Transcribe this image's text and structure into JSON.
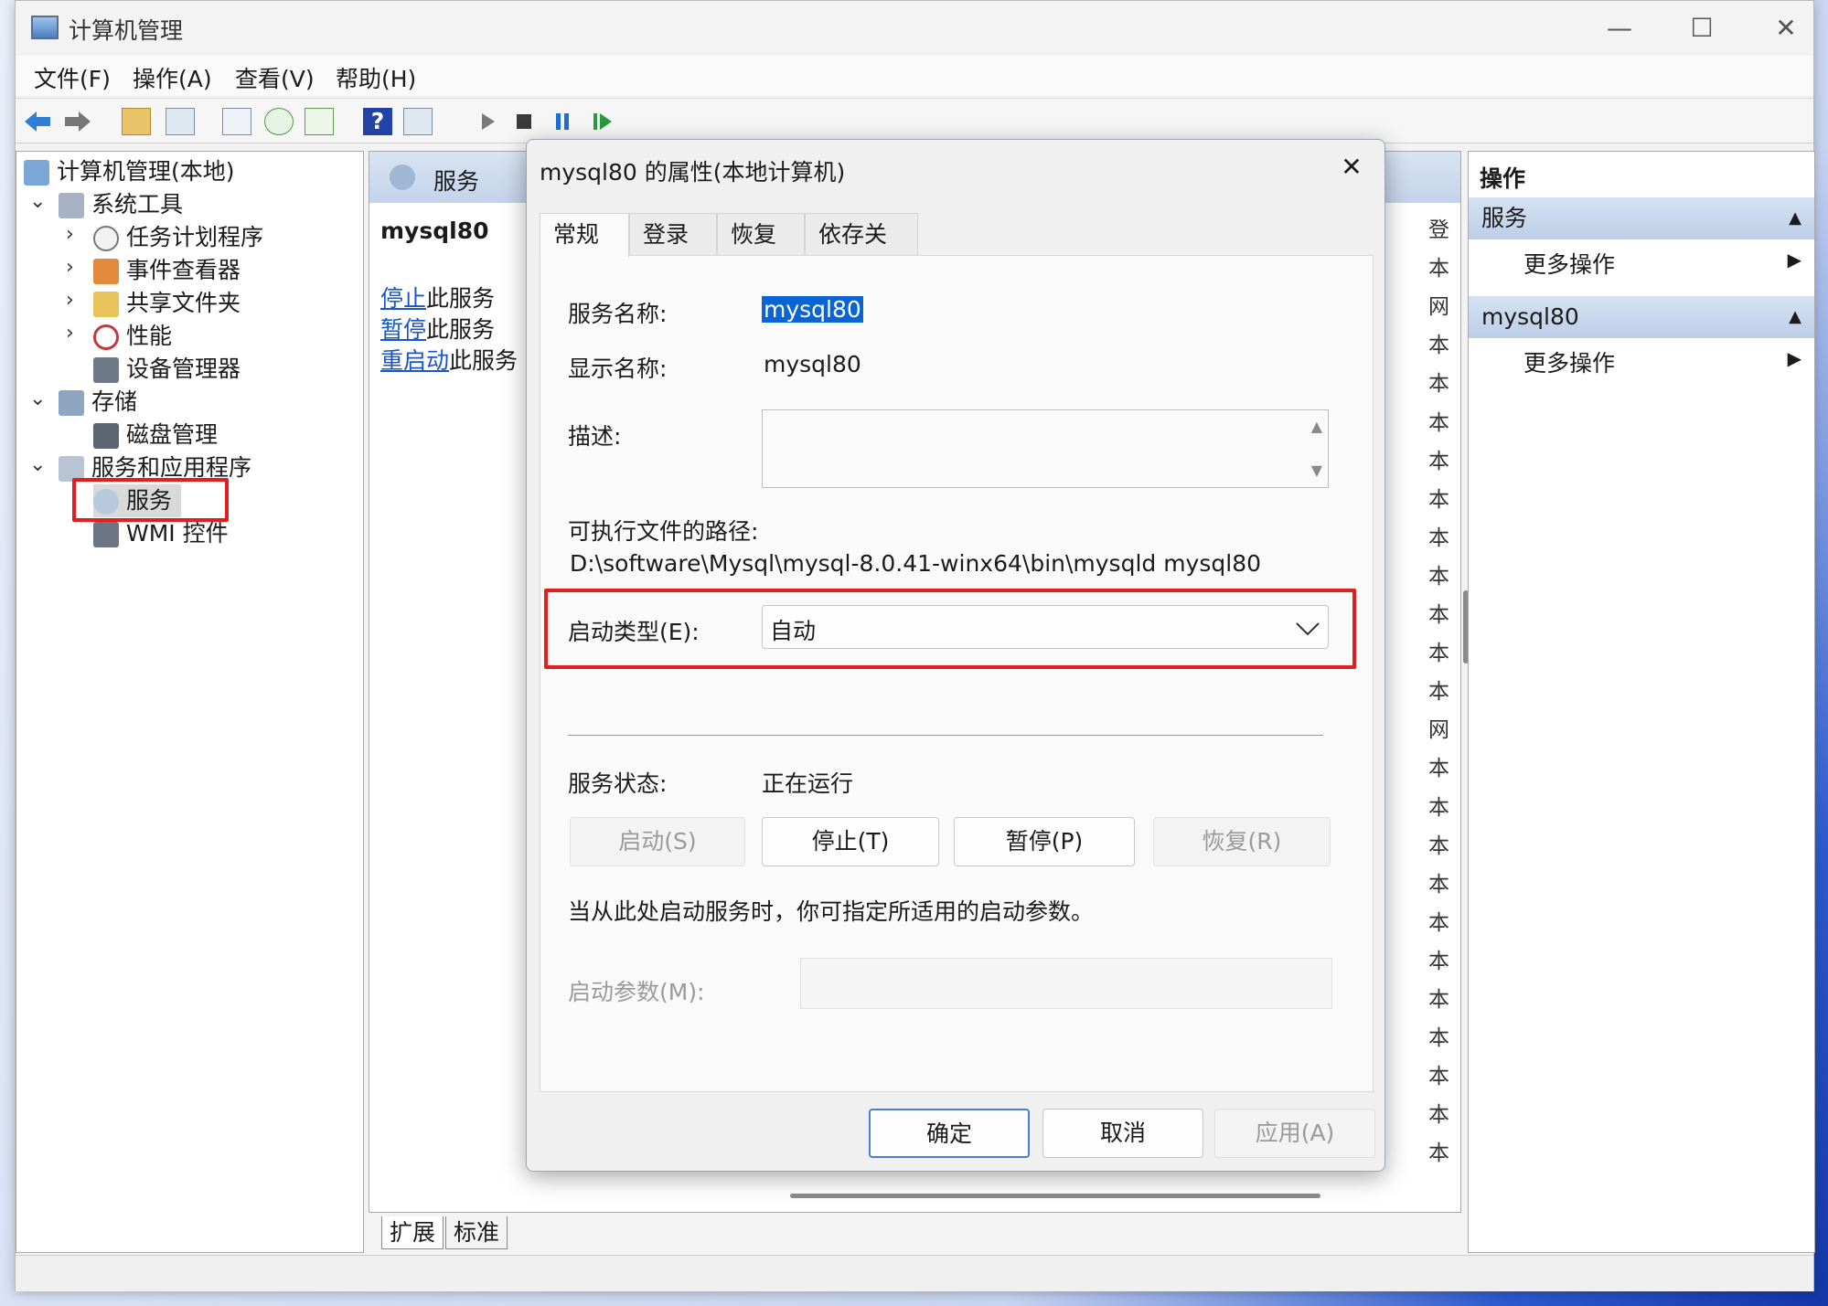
{
  "window": {
    "title": "计算机管理",
    "controls": {
      "minimize": "—",
      "maximize": "☐",
      "close": "✕"
    }
  },
  "menu": [
    "文件(F)",
    "操作(A)",
    "查看(V)",
    "帮助(H)"
  ],
  "tree": {
    "root": "计算机管理(本地)",
    "system_tools": "系统工具",
    "task_scheduler": "任务计划程序",
    "event_viewer": "事件查看器",
    "shared_folders": "共享文件夹",
    "performance": "性能",
    "device_manager": "设备管理器",
    "storage": "存储",
    "disk_mgmt": "磁盘管理",
    "services_apps": "服务和应用程序",
    "services": "服务",
    "wmi": "WMI 控件"
  },
  "middle": {
    "header": "服务",
    "service_name": "mysql80",
    "links": [
      {
        "link": "停止",
        "rest": "此服务"
      },
      {
        "link": "暂停",
        "rest": "此服务"
      },
      {
        "link": "重启动",
        "rest": "此服务"
      }
    ],
    "column_chars": [
      "登",
      "本",
      "网",
      "本",
      "本",
      "本",
      "本",
      "本",
      "本",
      "本",
      "本",
      "本",
      "本",
      "网",
      "本",
      "本",
      "本",
      "本",
      "本",
      "本",
      "本",
      "本",
      "本",
      "本",
      "本"
    ],
    "bottom_tabs": [
      "扩展",
      "标准"
    ]
  },
  "actions": {
    "title": "操作",
    "sections": [
      {
        "name": "服务",
        "more": "更多操作"
      },
      {
        "name": "mysql80",
        "more": "更多操作"
      }
    ]
  },
  "dialog": {
    "title": "mysql80 的属性(本地计算机)",
    "close": "✕",
    "tabs": [
      "常规",
      "登录",
      "恢复",
      "依存关系"
    ],
    "service_name_label": "服务名称:",
    "service_name": "mysql80",
    "display_name_label": "显示名称:",
    "display_name": "mysql80",
    "description_label": "描述:",
    "description": "",
    "exe_path_label": "可执行文件的路径:",
    "exe_path": "D:\\software\\Mysql\\mysql-8.0.41-winx64\\bin\\mysqld mysql80",
    "startup_type_label": "启动类型(E):",
    "startup_type": "自动",
    "status_label": "服务状态:",
    "status": "正在运行",
    "buttons": {
      "start": "启动(S)",
      "stop": "停止(T)",
      "pause": "暂停(P)",
      "resume": "恢复(R)"
    },
    "hint": "当从此处启动服务时，你可指定所适用的启动参数。",
    "params_label": "启动参数(M):",
    "params": "",
    "ok": "确定",
    "cancel": "取消",
    "apply": "应用(A)"
  },
  "colors": {
    "highlight": "#e02020",
    "link": "#1a56c8",
    "selection": "#0a64d4"
  }
}
